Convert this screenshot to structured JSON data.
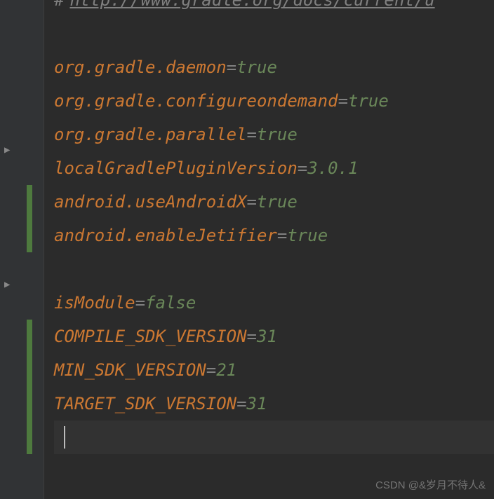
{
  "comment": {
    "hash": "#",
    "url": "http://www.gradle.org/docs/current/u"
  },
  "lines": [
    {
      "key": "org.gradle.daemon",
      "value": "true",
      "valueClass": "value-true"
    },
    {
      "key": "org.gradle.configureondemand",
      "value": "true",
      "valueClass": "value-true"
    },
    {
      "key": "org.gradle.parallel",
      "value": "true",
      "valueClass": "value-true"
    },
    {
      "key": "localGradlePluginVersion",
      "value": "3.0.1",
      "valueClass": "value-num"
    },
    {
      "key": "android.useAndroidX",
      "value": "true",
      "valueClass": "value-true"
    },
    {
      "key": "android.enableJetifier",
      "value": "true",
      "valueClass": "value-true"
    }
  ],
  "lines2": [
    {
      "key": "isModule",
      "value": "false",
      "valueClass": "value-false"
    },
    {
      "key": "COMPILE_SDK_VERSION",
      "value": "31",
      "valueClass": "value-num"
    },
    {
      "key": "MIN_SDK_VERSION",
      "value": "21",
      "valueClass": "value-num"
    },
    {
      "key": "TARGET_SDK_VERSION",
      "value": "31",
      "valueClass": "value-num"
    }
  ],
  "equals": "=",
  "watermark": "CSDN @&岁月不待人&"
}
